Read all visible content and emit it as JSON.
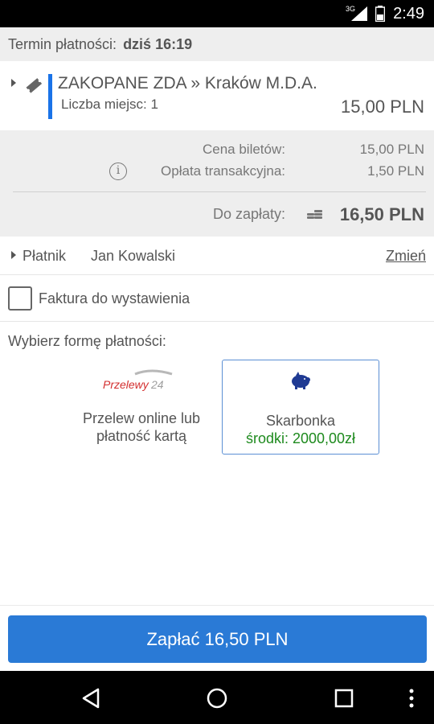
{
  "status_bar": {
    "network": "3G",
    "time": "2:49"
  },
  "deadline": {
    "label": "Termin płatności:",
    "value": "dziś 16:19"
  },
  "trip": {
    "route": "ZAKOPANE ZDA » Kraków  M.D.A.",
    "seats": "Liczba miejsc: 1",
    "price": "15,00 PLN",
    "accent_color": "#1a73e8"
  },
  "summary": {
    "ticket_price_label": "Cena biletów:",
    "ticket_price_value": "15,00 PLN",
    "fee_label": "Opłata transakcyjna:",
    "fee_value": "1,50 PLN",
    "total_label": "Do zapłaty:",
    "total_value": "16,50 PLN",
    "info_icon": "i"
  },
  "payer": {
    "label": "Płatnik",
    "name": "Jan Kowalski",
    "change_label": "Zmień"
  },
  "invoice": {
    "label": "Faktura do wystawienia",
    "checked": false
  },
  "payment": {
    "heading": "Wybierz formę płatności:",
    "options": [
      {
        "logo_text": "Przelewy24",
        "line1": "Przelew online lub",
        "line2": "płatność kartą"
      },
      {
        "line1": "Skarbonka",
        "line2": "środki: 2000,00zł",
        "selected": true
      }
    ]
  },
  "pay_button": {
    "label": "Zapłać 16,50 PLN",
    "color": "#2a7ad6"
  }
}
